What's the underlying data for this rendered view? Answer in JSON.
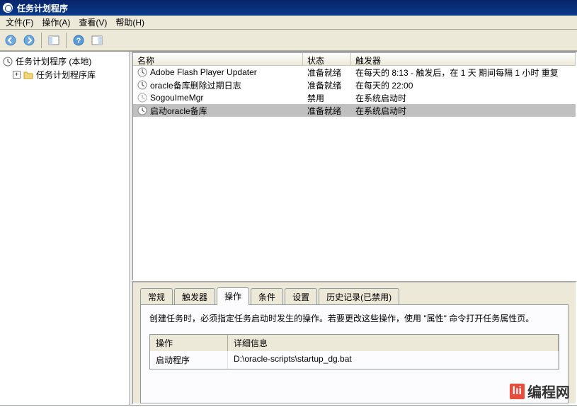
{
  "window": {
    "title": "任务计划程序"
  },
  "menu": {
    "file": "文件(F)",
    "action": "操作(A)",
    "view": "查看(V)",
    "help": "帮助(H)"
  },
  "tree": {
    "root": "任务计划程序 (本地)",
    "library": "任务计划程序库"
  },
  "list": {
    "headers": {
      "name": "名称",
      "status": "状态",
      "trigger": "触发器"
    },
    "rows": [
      {
        "name": "Adobe Flash Player Updater",
        "status": "准备就绪",
        "trigger": "在每天的 8:13 - 触发后，在 1 天 期间每隔 1 小时 重复"
      },
      {
        "name": "oracle备库删除过期日志",
        "status": "准备就绪",
        "trigger": "在每天的 22:00"
      },
      {
        "name": "SogouImeMgr",
        "status": "禁用",
        "trigger": "在系统启动时"
      },
      {
        "name": "启动oracle备库",
        "status": "准备就绪",
        "trigger": "在系统启动时"
      }
    ]
  },
  "detail": {
    "tabs": {
      "general": "常规",
      "triggers": "触发器",
      "actions": "操作",
      "conditions": "条件",
      "settings": "设置",
      "history": "历史记录(已禁用)"
    },
    "desc": "创建任务时，必须指定任务启动时发生的操作。若要更改这些操作，使用 \"属性\" 命令打开任务属性页。",
    "table": {
      "headers": {
        "op": "操作",
        "detail": "详细信息"
      },
      "row": {
        "op": "启动程序",
        "detail": "D:\\oracle-scripts\\startup_dg.bat"
      }
    }
  },
  "watermark": "编程网"
}
